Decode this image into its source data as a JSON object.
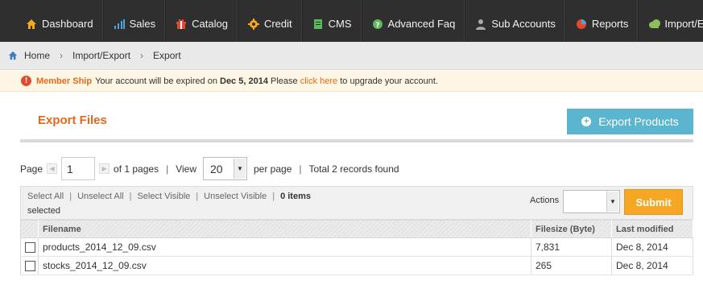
{
  "nav": [
    {
      "label": "Dashboard",
      "icon": "home-icon",
      "color": "#f5a623"
    },
    {
      "label": "Sales",
      "icon": "bar-chart-icon",
      "color": "#4ea3dc"
    },
    {
      "label": "Catalog",
      "icon": "gift-icon",
      "color": "#e04b2f"
    },
    {
      "label": "Credit",
      "icon": "gear-icon",
      "color": "#f5a623"
    },
    {
      "label": "CMS",
      "icon": "document-icon",
      "color": "#5cb85c"
    },
    {
      "label": "Advanced Faq",
      "icon": "question-icon",
      "color": "#5cb85c"
    },
    {
      "label": "Sub Accounts",
      "icon": "users-icon",
      "color": "#999999"
    },
    {
      "label": "Reports",
      "icon": "pie-chart-icon",
      "color": "#e04b2f"
    },
    {
      "label": "Import/Export",
      "icon": "cloud-icon",
      "color": "#8bbf5a"
    }
  ],
  "breadcrumb": {
    "home": "Home",
    "parent": "Import/Export",
    "current": "Export"
  },
  "notice": {
    "title": "Member Ship",
    "text_before": "Your account will be expired on",
    "date": "Dec 5, 2014",
    "text_mid": "Please",
    "link": "click here",
    "text_after": "to upgrade your account."
  },
  "header": {
    "title": "Export Files",
    "button": "Export Products"
  },
  "pager": {
    "page_label": "Page",
    "page_value": "1",
    "of_pages": "of 1 pages",
    "view_label": "View",
    "view_value": "20",
    "per_page": "per page",
    "total": "Total 2 records found"
  },
  "massaction": {
    "select_all": "Select All",
    "unselect_all": "Unselect All",
    "select_visible": "Select Visible",
    "unselect_visible": "Unselect Visible",
    "count": "0 items",
    "selected_word": "selected",
    "actions_label": "Actions",
    "submit": "Submit"
  },
  "grid": {
    "headers": [
      "Filename",
      "Filesize (Byte)",
      "Last modified"
    ],
    "rows": [
      {
        "filename": "products_2014_12_09.csv",
        "filesize": "7,831",
        "modified": "Dec 8, 2014"
      },
      {
        "filename": "stocks_2014_12_09.csv",
        "filesize": "265",
        "modified": "Dec 8, 2014"
      }
    ]
  },
  "colors": {
    "accent": "#e0691b",
    "button_blue": "#5bb5cf",
    "submit_orange": "#f5a623",
    "nav_bg": "#2f2f2f"
  }
}
